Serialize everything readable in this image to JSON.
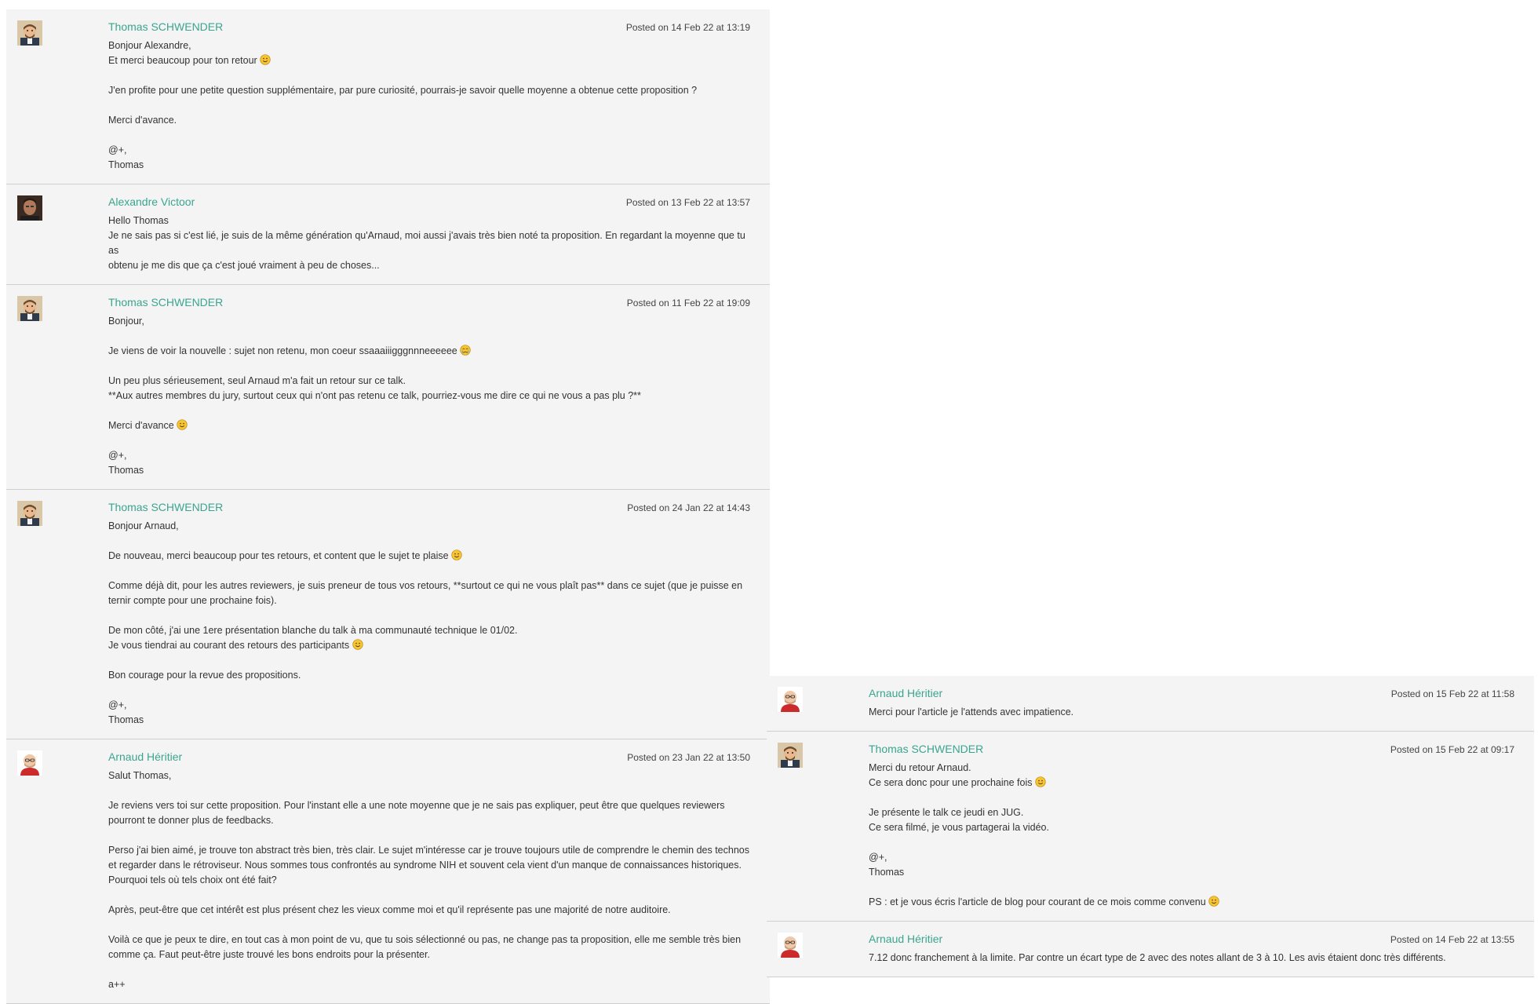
{
  "left_column": [
    {
      "author": "Thomas SCHWENDER",
      "date": "Posted on 14 Feb 22 at 13:19",
      "avatar": "thomas",
      "lines": [
        {
          "text": "Bonjour Alexandre,"
        },
        {
          "text": "Et merci beaucoup pour ton retour",
          "emoji": "smile"
        },
        {
          "text": ""
        },
        {
          "text": "J'en profite pour une petite question supplémentaire, par pure curiosité, pourrais-je savoir quelle moyenne a obtenue cette proposition ?"
        },
        {
          "text": ""
        },
        {
          "text": "Merci d'avance."
        },
        {
          "text": ""
        },
        {
          "text": "@+,"
        },
        {
          "text": "Thomas"
        }
      ]
    },
    {
      "author": "Alexandre Victoor",
      "date": "Posted on 13 Feb 22 at 13:57",
      "avatar": "alexandre",
      "lines": [
        {
          "text": "Hello Thomas"
        },
        {
          "text": "Je ne sais pas si c'est lié, je suis de la même génération qu'Arnaud, moi aussi j'avais très bien noté ta proposition. En regardant la moyenne que tu as"
        },
        {
          "text": "obtenu je me dis que ça c'est joué vraiment à peu de choses..."
        }
      ]
    },
    {
      "author": "Thomas SCHWENDER",
      "date": "Posted on 11 Feb 22 at 19:09",
      "avatar": "thomas",
      "lines": [
        {
          "text": "Bonjour,"
        },
        {
          "text": ""
        },
        {
          "text": "Je viens de voir la nouvelle : sujet non retenu, mon coeur ssaaaiiigggnnneeeeee",
          "emoji": "cry"
        },
        {
          "text": ""
        },
        {
          "text": "Un peu plus sérieusement, seul Arnaud m'a fait un retour sur ce talk."
        },
        {
          "text": "**Aux autres membres du jury, surtout ceux qui n'ont pas retenu ce talk, pourriez-vous me dire ce qui ne vous a pas plu ?**"
        },
        {
          "text": ""
        },
        {
          "text": "Merci d'avance",
          "emoji": "smile"
        },
        {
          "text": ""
        },
        {
          "text": "@+,"
        },
        {
          "text": "Thomas"
        }
      ]
    },
    {
      "author": "Thomas SCHWENDER",
      "date": "Posted on 24 Jan 22 at 14:43",
      "avatar": "thomas",
      "lines": [
        {
          "text": "Bonjour Arnaud,"
        },
        {
          "text": ""
        },
        {
          "text": "De nouveau, merci beaucoup pour tes retours, et content que le sujet te plaise",
          "emoji": "smile"
        },
        {
          "text": ""
        },
        {
          "text": "Comme déjà dit, pour les autres reviewers, je suis preneur de tous vos retours, **surtout ce qui ne vous plaît pas** dans ce sujet (que je puisse en"
        },
        {
          "text": "ternir compte pour une prochaine fois)."
        },
        {
          "text": ""
        },
        {
          "text": "De mon côté, j'ai une 1ere présentation blanche du talk à ma communauté technique le 01/02."
        },
        {
          "text": "Je vous tiendrai au courant des retours des participants",
          "emoji": "smile"
        },
        {
          "text": ""
        },
        {
          "text": "Bon courage pour la revue des propositions."
        },
        {
          "text": ""
        },
        {
          "text": "@+,"
        },
        {
          "text": "Thomas"
        }
      ]
    },
    {
      "author": "Arnaud Héritier",
      "date": "Posted on 23 Jan 22 at 13:50",
      "avatar": "arnaud",
      "lines": [
        {
          "text": "Salut Thomas,"
        },
        {
          "text": ""
        },
        {
          "text": "Je reviens vers toi sur cette proposition. Pour l'instant elle a une note moyenne que je ne sais pas expliquer, peut être que quelques reviewers"
        },
        {
          "text": "pourront te donner plus de feedbacks."
        },
        {
          "text": ""
        },
        {
          "text": "Perso j'ai bien aimé, je trouve ton abstract très bien, très clair. Le sujet m'intéresse car je trouve toujours utile de comprendre le chemin des technos"
        },
        {
          "text": "et regarder dans le rétroviseur. Nous sommes tous confrontés au syndrome NIH et souvent cela vient d'un manque de connaissances historiques."
        },
        {
          "text": "Pourquoi tels où tels choix ont été fait?"
        },
        {
          "text": ""
        },
        {
          "text": "Après, peut-être que cet intérêt est plus présent chez les vieux comme moi et qu'il représente pas une majorité de notre auditoire."
        },
        {
          "text": ""
        },
        {
          "text": "Voilà ce que je peux te dire, en tout cas à mon point de vu, que tu sois sélectionné ou pas, ne change pas ta proposition, elle me semble très bien"
        },
        {
          "text": "comme ça. Faut peut-être juste trouvé les bons endroits pour la présenter."
        },
        {
          "text": ""
        },
        {
          "text": "a++"
        }
      ]
    }
  ],
  "right_column": [
    {
      "author": "Arnaud Héritier",
      "date": "Posted on 15 Feb 22 at 11:58",
      "avatar": "arnaud",
      "lines": [
        {
          "text": "Merci pour l'article je l'attends avec impatience."
        }
      ]
    },
    {
      "author": "Thomas SCHWENDER",
      "date": "Posted on 15 Feb 22 at 09:17",
      "avatar": "thomas",
      "lines": [
        {
          "text": "Merci du retour Arnaud."
        },
        {
          "text": "Ce sera donc pour une prochaine fois",
          "emoji": "smile"
        },
        {
          "text": ""
        },
        {
          "text": "Je présente le talk ce jeudi en JUG."
        },
        {
          "text": "Ce sera filmé, je vous partagerai la vidéo."
        },
        {
          "text": ""
        },
        {
          "text": "@+,"
        },
        {
          "text": "Thomas"
        },
        {
          "text": ""
        },
        {
          "text": "PS : et je vous écris l'article de blog pour courant de ce mois comme convenu",
          "emoji": "smile"
        }
      ]
    },
    {
      "author": "Arnaud Héritier",
      "date": "Posted on 14 Feb 22 at 13:55",
      "avatar": "arnaud",
      "lines": [
        {
          "text": "7.12 donc franchement à la limite. Par contre un écart type de 2 avec des notes allant de 3 à 10. Les avis étaient donc très différents."
        }
      ]
    }
  ],
  "colors": {
    "author": "#3aa58f",
    "card_background": "#f4f4f4",
    "divider": "#cfcfcf"
  }
}
